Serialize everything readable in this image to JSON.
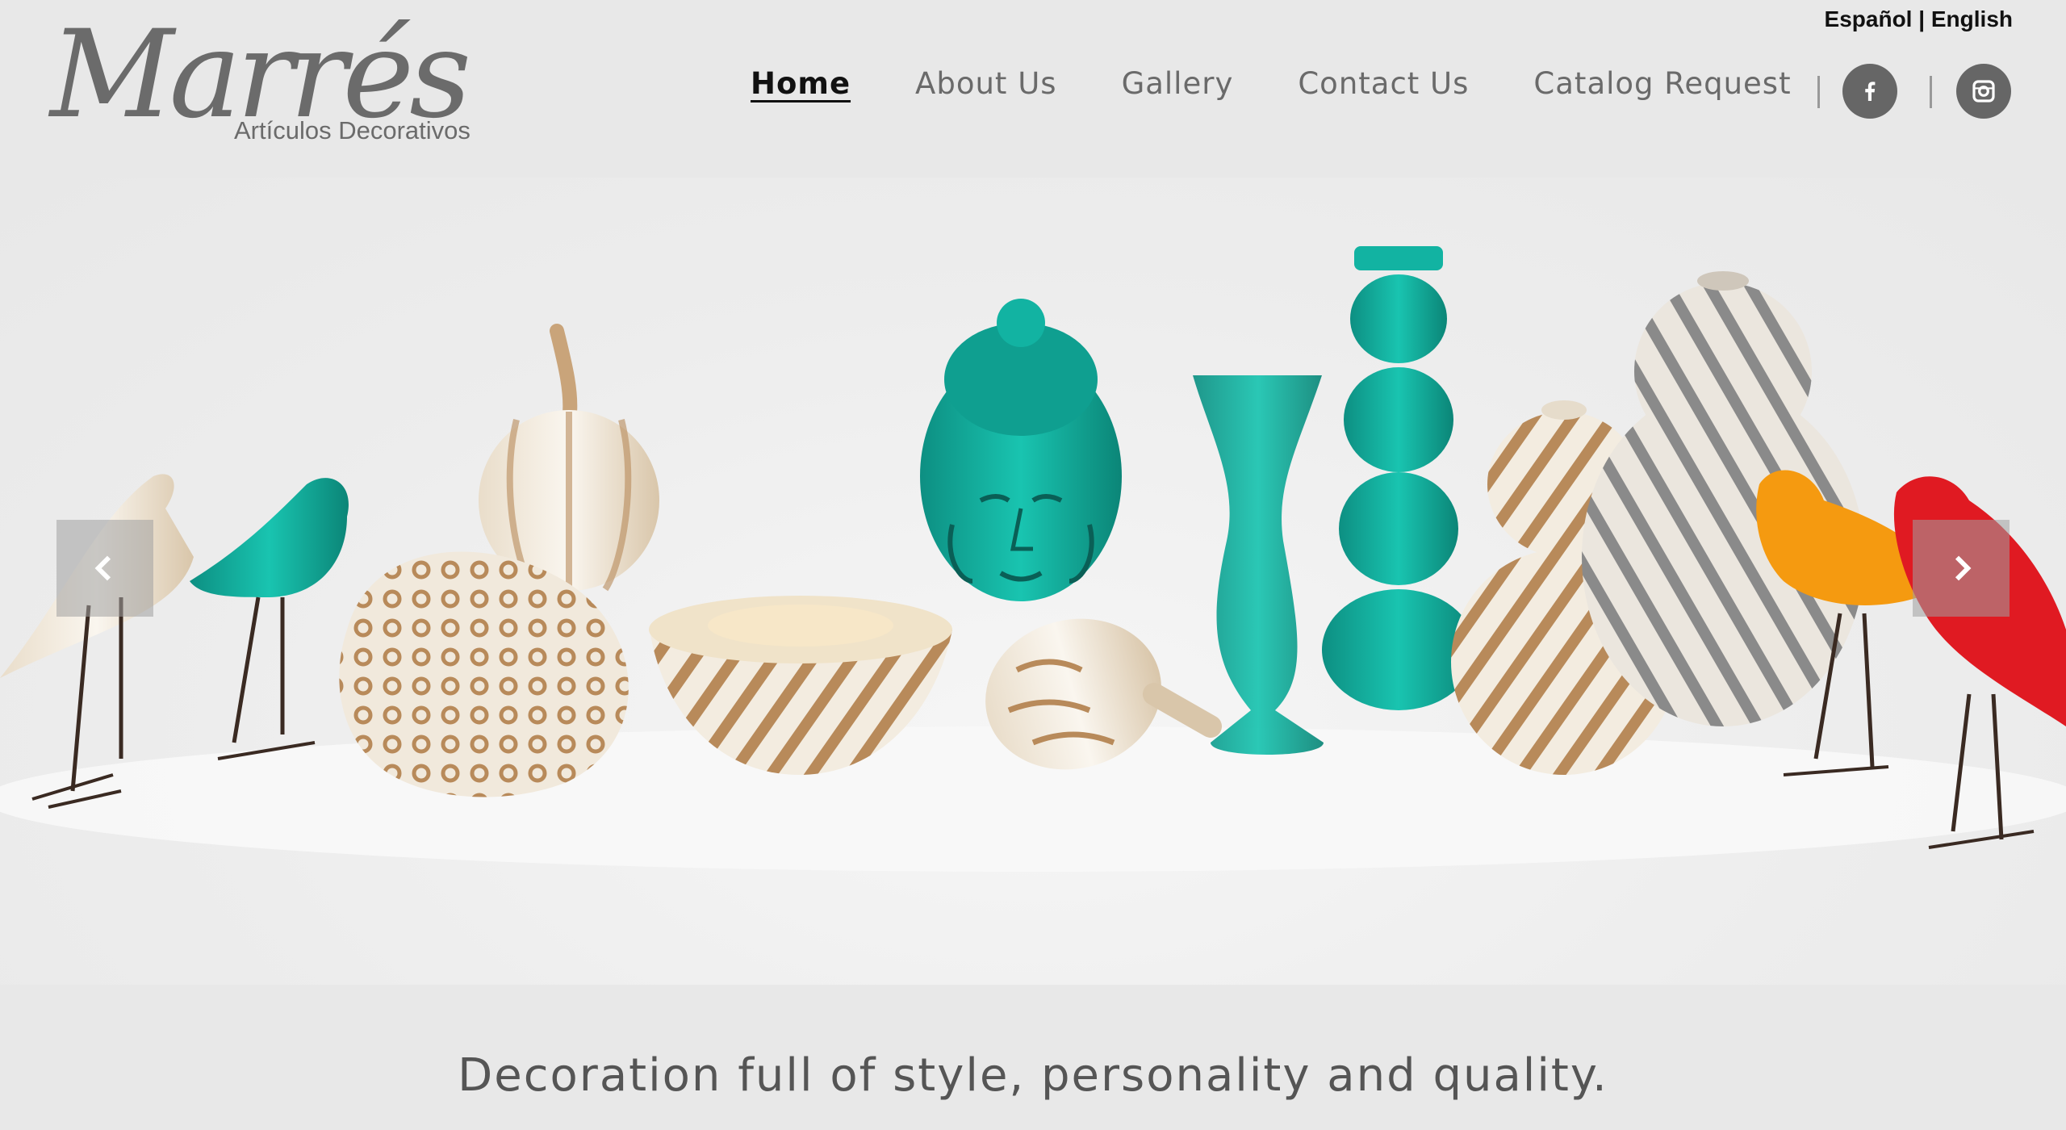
{
  "header": {
    "lang_es": "Español",
    "lang_sep": "|",
    "lang_en": "English",
    "logo_script": "Marrés",
    "logo_sub": "Artículos Decorativos"
  },
  "nav": {
    "items": [
      {
        "label": "Home",
        "active": true
      },
      {
        "label": "About Us",
        "active": false
      },
      {
        "label": "Gallery",
        "active": false
      },
      {
        "label": "Contact Us",
        "active": false
      },
      {
        "label": "Catalog Request",
        "active": false
      }
    ]
  },
  "social": {
    "facebook_icon": "facebook-icon",
    "instagram_icon": "instagram-icon"
  },
  "carousel": {
    "prev_icon": "chevron-left-icon",
    "next_icon": "chevron-right-icon",
    "colors": {
      "teal": "#12b3a2",
      "gold": "#b88a5a",
      "cream": "#f3ece0",
      "orange": "#f59a10",
      "red": "#e01a22",
      "grey": "#8a8a8a"
    }
  },
  "tagline": "Decoration full of style, personality and quality."
}
